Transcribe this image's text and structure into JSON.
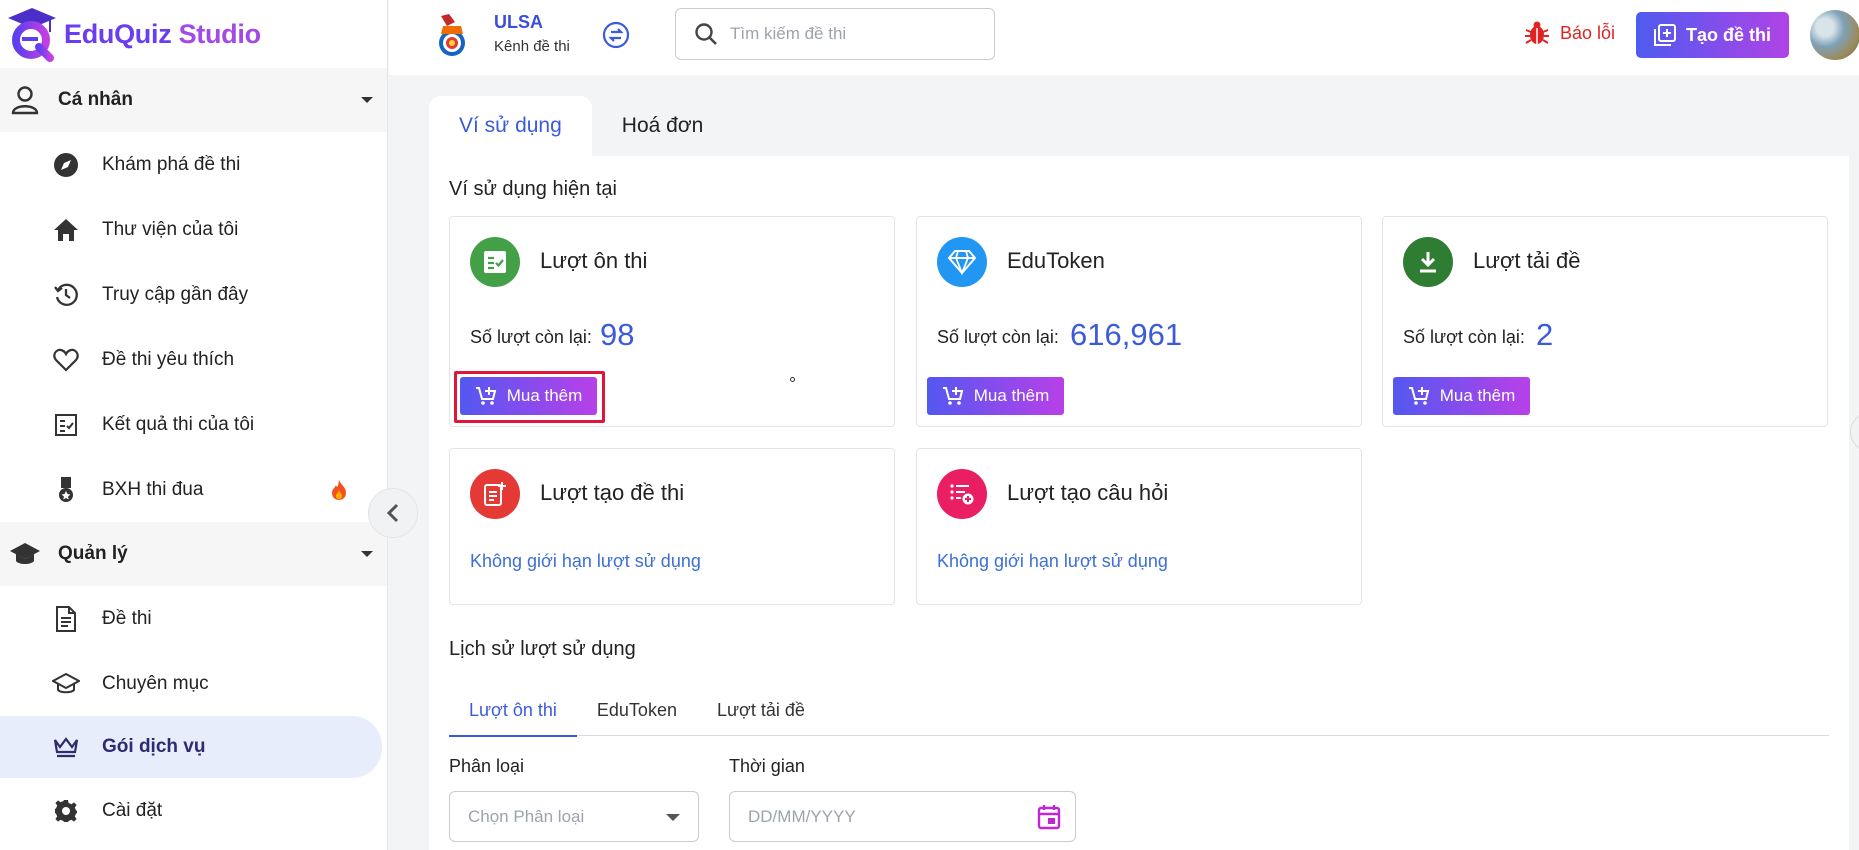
{
  "app": {
    "name_part1": "EduQuiz",
    "name_part2": " Studio"
  },
  "sidebar": {
    "personal": {
      "label": "Cá nhân"
    },
    "personal_items": [
      {
        "label": "Khám phá đề thi",
        "icon": "compass-icon"
      },
      {
        "label": "Thư viện của tôi",
        "icon": "home-icon"
      },
      {
        "label": "Truy cập gần đây",
        "icon": "history-icon"
      },
      {
        "label": "Đề thi yêu thích",
        "icon": "heart-icon"
      },
      {
        "label": "Kết quả thi của tôi",
        "icon": "checklist-icon"
      },
      {
        "label": "BXH thi đua",
        "icon": "medal-icon"
      }
    ],
    "manage": {
      "label": "Quản lý"
    },
    "manage_items": [
      {
        "label": "Đề thi",
        "icon": "document-icon"
      },
      {
        "label": "Chuyên mục",
        "icon": "graduation-cap-icon"
      },
      {
        "label": "Gói dịch vụ",
        "icon": "crown-icon",
        "active": true
      },
      {
        "label": "Cài đặt",
        "icon": "gear-icon"
      }
    ]
  },
  "header": {
    "channel_name": "ULSA",
    "channel_sub": "Kênh đề thi",
    "search_placeholder": "Tìm kiếm đề thi",
    "report_label": "Báo lỗi",
    "create_label": "Tạo đề thi"
  },
  "tabs": {
    "wallet": "Ví sử dụng",
    "invoice": "Hoá đơn"
  },
  "wallet": {
    "title": "Ví sử dụng hiện tại",
    "remaining_label": "Số lượt còn lại:",
    "buy_label": "Mua thêm",
    "unlimited": "Không giới hạn lượt sử dụng",
    "cards": [
      {
        "title": "Lượt ôn thi",
        "value": "98",
        "color": "#43a047"
      },
      {
        "title": "EduToken",
        "value": "616,961",
        "color": "#2196f3"
      },
      {
        "title": "Lượt tải đề",
        "value": "2",
        "color": "#2e7d32"
      },
      {
        "title": "Lượt tạo đề thi",
        "color": "#e53935"
      },
      {
        "title": "Lượt tạo câu hỏi",
        "color": "#e91e63"
      }
    ]
  },
  "history": {
    "title": "Lịch sử lượt sử dụng",
    "tabs": [
      "Lượt ôn thi",
      "EduToken",
      "Lượt tải đề"
    ],
    "filter_type_label": "Phân loại",
    "filter_type_placeholder": "Chọn Phân loại",
    "filter_time_label": "Thời gian",
    "filter_time_placeholder": "DD/MM/YYYY"
  },
  "colors": {
    "accent": "#3b5bdb",
    "brand": "#6a3df0",
    "error": "#e02424"
  }
}
